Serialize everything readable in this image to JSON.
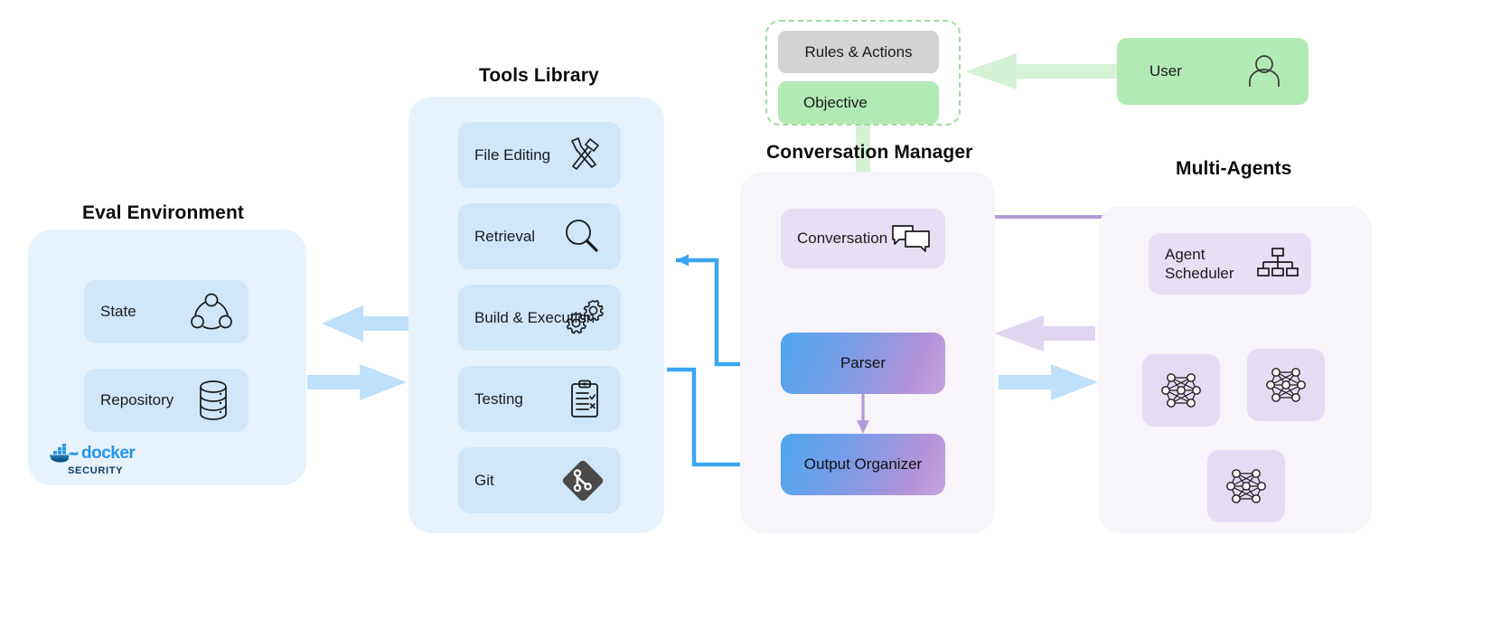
{
  "diagram": {
    "sections": [
      {
        "id": "eval",
        "title": "Eval Environment"
      },
      {
        "id": "tools",
        "title": "Tools Library"
      },
      {
        "id": "convmgr",
        "title": "Conversation Manager"
      },
      {
        "id": "agents",
        "title": "Multi-Agents"
      }
    ]
  },
  "eval_environment": {
    "title": "Eval Environment",
    "items": [
      {
        "label": "State",
        "icon": "state-graph-icon"
      },
      {
        "label": "Repository",
        "icon": "database-icon"
      }
    ],
    "badge": {
      "name": "docker",
      "sub": "SECURITY",
      "icon": "docker-whale-icon",
      "color": "#2496ed"
    }
  },
  "tools_library": {
    "title": "Tools Library",
    "items": [
      {
        "label": "File Editing",
        "icon": "hammer-tools-icon"
      },
      {
        "label": "Retrieval",
        "icon": "magnifier-icon"
      },
      {
        "label": "Build & Execution",
        "icon": "gears-icon"
      },
      {
        "label": "Testing",
        "icon": "clipboard-checklist-icon"
      },
      {
        "label": "Git",
        "icon": "git-logo-icon"
      }
    ]
  },
  "conversation_manager": {
    "title": "Conversation Manager",
    "inputs": [
      {
        "label": "Rules & Actions",
        "style": "grey"
      },
      {
        "label": "Objective",
        "style": "green"
      }
    ],
    "blocks": [
      {
        "label": "Conversation",
        "icon": "chat-bubbles-icon",
        "style": "lavender"
      },
      {
        "label": "Parser",
        "style": "gradient"
      },
      {
        "label": "Output Organizer",
        "style": "gradient"
      }
    ]
  },
  "multi_agents": {
    "title": "Multi-Agents",
    "scheduler": {
      "label": "Agent\nScheduler",
      "icon": "org-chart-icon"
    },
    "agents": [
      {
        "icon": "neural-net-icon"
      },
      {
        "icon": "neural-net-icon"
      },
      {
        "icon": "neural-net-icon"
      }
    ]
  },
  "user": {
    "label": "User",
    "icon": "person-icon",
    "color": "#b2eab4"
  },
  "colors": {
    "blue_panel": "#e7f2fd",
    "blue_card": "#cfe6fb",
    "lavender_panel": "#f7f4fa",
    "lavender_card": "#e7dff4",
    "green": "#b2eab4",
    "grey": "#d3d3d3",
    "arrow_blue_thick": "#bfe0fa",
    "arrow_blue_line": "#3aa6f0",
    "arrow_purple": "#b49ad8",
    "arrow_purple_pale": "#e0d5ef",
    "arrow_green_pale": "#d6f2d6",
    "gradient_from": "#4da6f0",
    "gradient_to": "#c7a3dd"
  }
}
